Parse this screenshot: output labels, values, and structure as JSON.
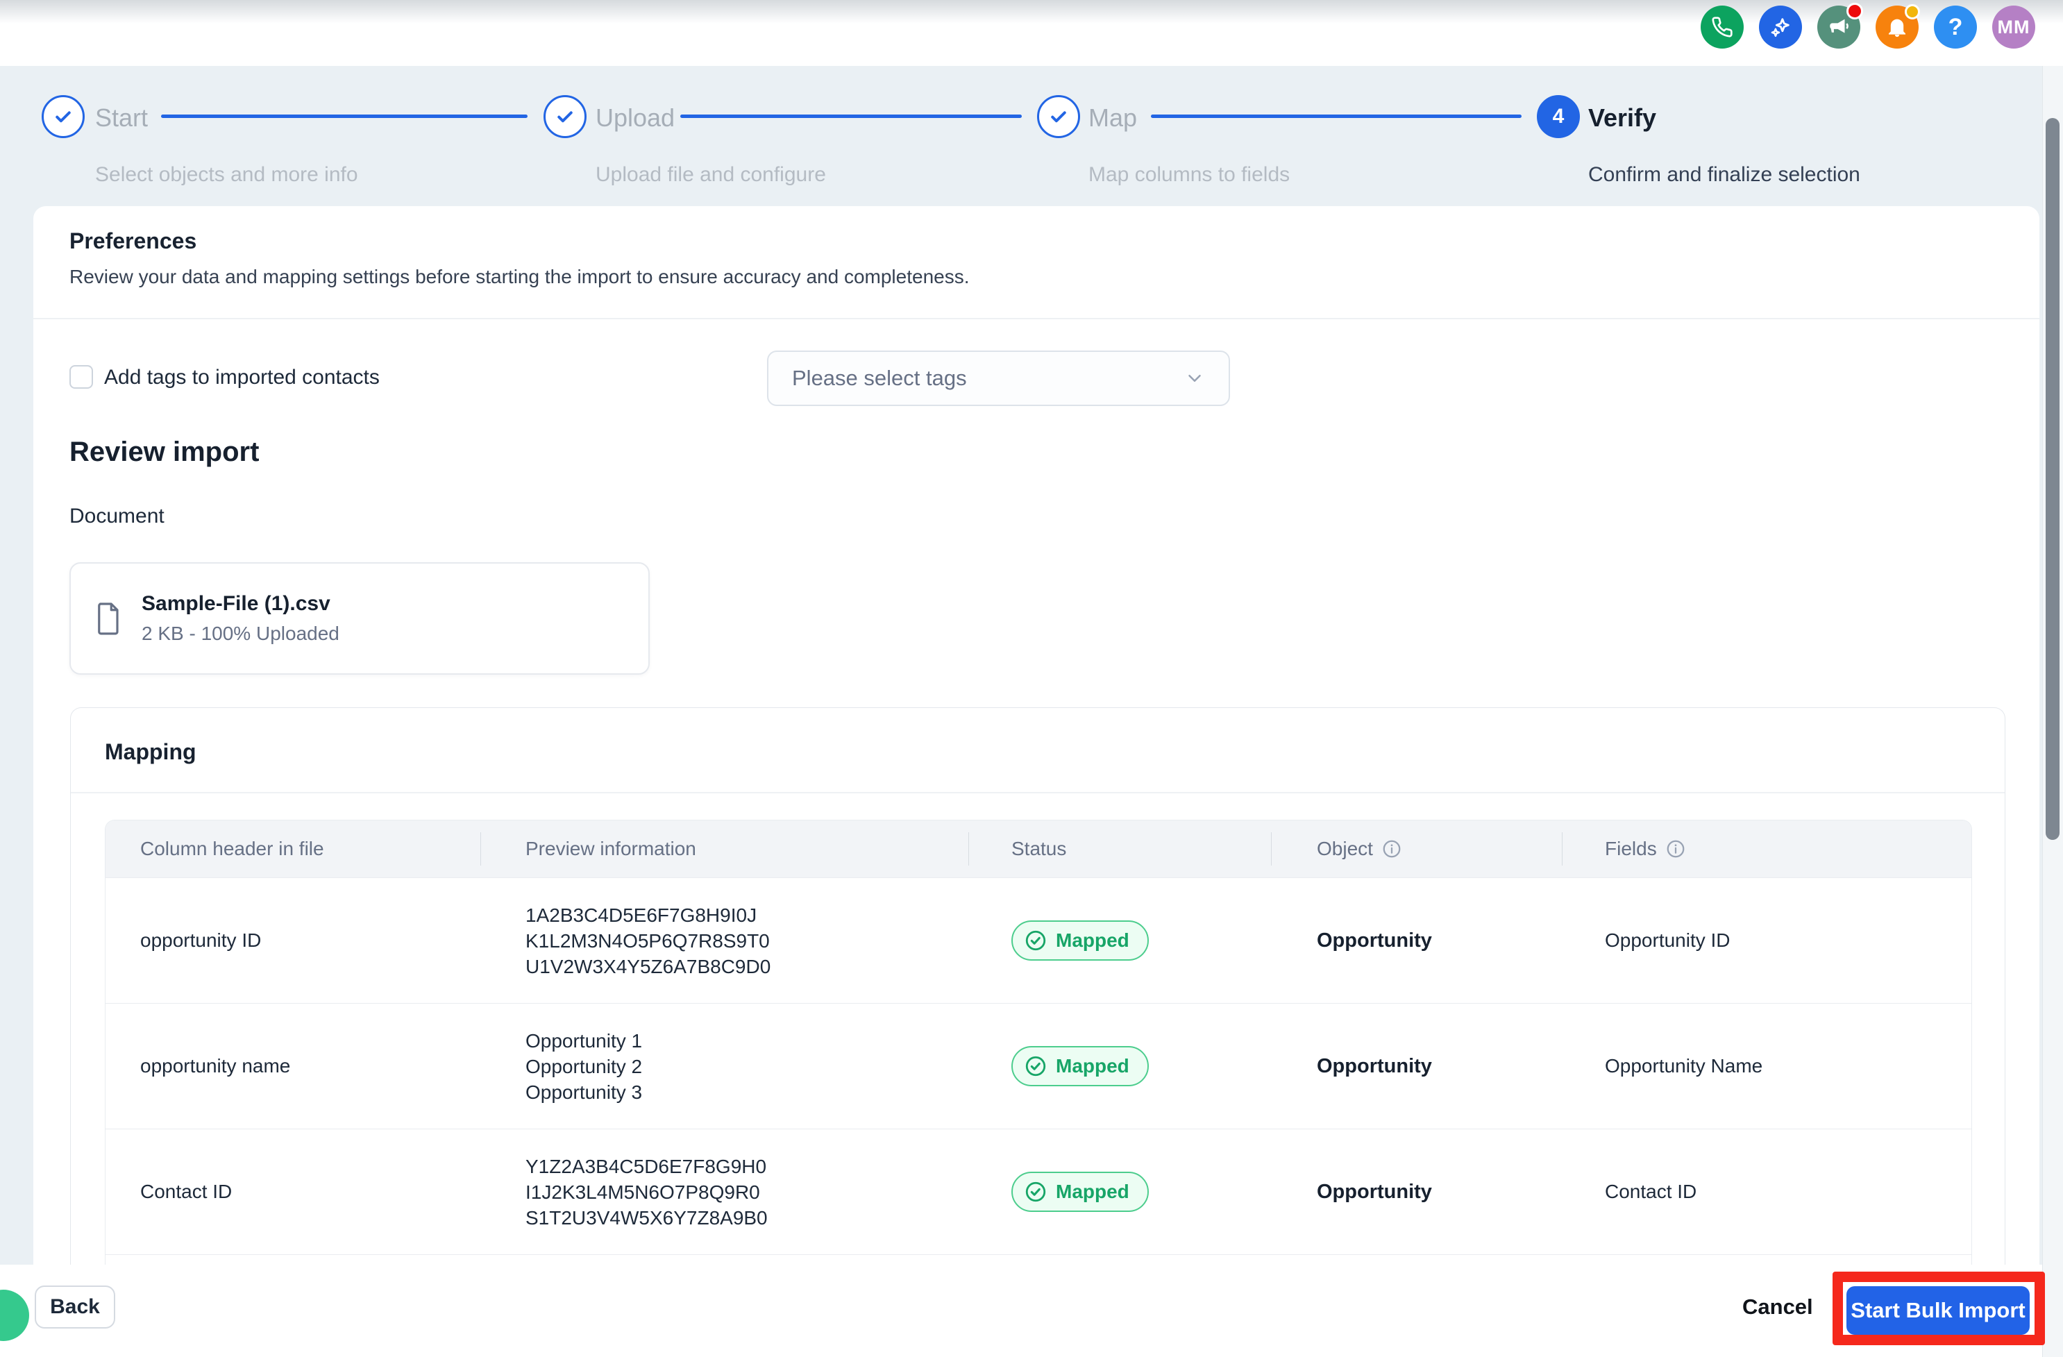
{
  "topbar": {
    "icons": [
      {
        "name": "phone-icon",
        "color": "#0ca35f"
      },
      {
        "name": "ai-sparkle-icon",
        "color": "#2265e4"
      },
      {
        "name": "announcements-icon",
        "color": "#55917c",
        "badge": "red-dot"
      },
      {
        "name": "notifications-bell-icon",
        "color": "#f7820d",
        "badge": "amber-dot"
      },
      {
        "name": "help-icon",
        "color": "#2e8ff2",
        "glyph": "?"
      }
    ],
    "avatar_initials": "MM"
  },
  "stepper": {
    "steps": [
      {
        "label": "Start",
        "subtitle": "Select objects and more info",
        "state": "done"
      },
      {
        "label": "Upload",
        "subtitle": "Upload file and configure",
        "state": "done"
      },
      {
        "label": "Map",
        "subtitle": "Map columns to fields",
        "state": "done"
      },
      {
        "label": "Verify",
        "subtitle": "Confirm and finalize selection",
        "state": "active",
        "number": "4"
      }
    ]
  },
  "preferences": {
    "title": "Preferences",
    "description": "Review your data and mapping settings before starting the import to ensure accuracy and completeness.",
    "add_tags_label": "Add tags to imported contacts",
    "add_tags_checked": false,
    "tags_placeholder": "Please select tags"
  },
  "review": {
    "title": "Review import",
    "document_label": "Document",
    "file": {
      "name": "Sample-File (1).csv",
      "meta": "2 KB - 100% Uploaded"
    }
  },
  "mapping": {
    "title": "Mapping",
    "columns": {
      "col1": "Column header in file",
      "col2": "Preview information",
      "col3": "Status",
      "col4": "Object",
      "col5": "Fields"
    },
    "rows": [
      {
        "header": "opportunity ID",
        "preview": [
          "1A2B3C4D5E6F7G8H9I0J",
          "K1L2M3N4O5P6Q7R8S9T0",
          "U1V2W3X4Y5Z6A7B8C9D0"
        ],
        "status": "Mapped",
        "object": "Opportunity",
        "field": "Opportunity ID"
      },
      {
        "header": "opportunity name",
        "preview": [
          "Opportunity 1",
          "Opportunity 2",
          "Opportunity 3"
        ],
        "status": "Mapped",
        "object": "Opportunity",
        "field": "Opportunity Name"
      },
      {
        "header": "Contact ID",
        "preview": [
          "Y1Z2A3B4C5D6E7F8G9H0",
          "I1J2K3L4M5N6O7P8Q9R0",
          "S1T2U3V4W5X6Y7Z8A9B0"
        ],
        "status": "Mapped",
        "object": "Opportunity",
        "field": "Contact ID"
      }
    ]
  },
  "footer": {
    "back_label": "Back",
    "cancel_label": "Cancel",
    "submit_label": "Start Bulk Import"
  },
  "colors": {
    "primary_blue": "#2265e4",
    "success_green": "#17a567",
    "success_bg": "#ecfdf3",
    "page_background": "#eaf0f4",
    "annotation_red": "#f5281c",
    "text_dark": "#1d2939",
    "text_muted": "#667085"
  }
}
